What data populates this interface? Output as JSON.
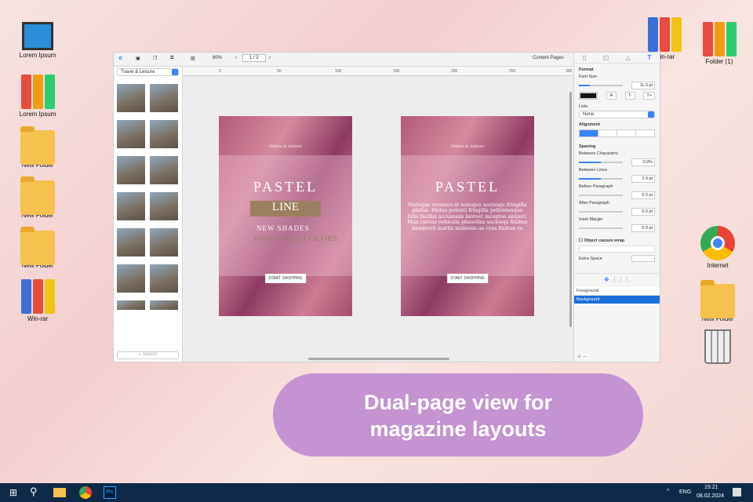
{
  "desktop": {
    "left_icons": [
      "Lorem Ipsum",
      "Lorem Ipsum",
      "New Folder",
      "New Folder",
      "New Folder",
      "Win-rar"
    ],
    "right_icons": [
      "Win-rar",
      "Folder (1)",
      "Internet",
      "New Folder"
    ]
  },
  "toolbar": {
    "zoom": "80%",
    "page": "1 / 2",
    "view": "Content Pages"
  },
  "left_panel": {
    "category": "Travel & Leisure",
    "search_placeholder": "Search"
  },
  "ruler": [
    "0",
    "50",
    "100",
    "150",
    "200",
    "250",
    "300"
  ],
  "page_left": {
    "tagline": "Online & instore",
    "title": "PASTEL",
    "line": "LINE",
    "sub1": "NEW SHADES",
    "sub2": "WATCH ALL COLORS",
    "button": "START SHOPPING"
  },
  "page_right": {
    "tagline": "Online & instore",
    "title": "PASTEL",
    "body": "Natoque vivamus at natoque sociosqu fringilla platea. Metus potenti fringilla pellentesque felis facilisi accumsan laoreet inceptos aliquet. Mus cursus vehicula phasellus sociosqu finibus hendrerit mattis molestie.ue cras finibus ve",
    "button": "START SHOPPING"
  },
  "inspector": {
    "format": "Format",
    "font_size_label": "Font Size",
    "font_size": "11.0 pt",
    "lists_label": "Lists",
    "lists_value": "None",
    "alignment_label": "Alignment",
    "spacing": "Spacing",
    "between_chars_label": "Between Characters",
    "between_chars": "0.0%",
    "between_lines_label": "Between Lines",
    "between_lines": "2.9 pt",
    "before_para_label": "Before Paragraph",
    "before_para": "0.0 pt",
    "after_para_label": "After Paragraph",
    "after_para": "0.0 pt",
    "inset_label": "Inset Margin",
    "inset": "0.0 pt",
    "wrap_label": "Object causes wrap",
    "extra_label": "Extra Space",
    "layers": [
      "Foreground",
      "Background"
    ]
  },
  "banner": {
    "line1": "Dual-page view for",
    "line2": "magazine layouts"
  },
  "taskbar": {
    "lang": "ENG",
    "time": "15:21",
    "date": "08.02.2024"
  }
}
